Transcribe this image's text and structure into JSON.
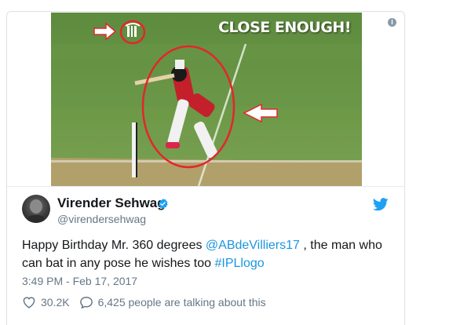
{
  "media": {
    "overlay_title": "CLOSE ENOUGH!"
  },
  "author": {
    "name": "Virender Sehwag",
    "handle": "@virendersehwag"
  },
  "tweet": {
    "text_1": "Happy Birthday Mr. 360 degrees ",
    "mention": "@ABdeVilliers17",
    "text_2": " , the man who can bat in any pose he wishes too ",
    "hashtag": "#IPLlogo",
    "timestamp": "3:49 PM - Feb 17, 2017"
  },
  "actions": {
    "likes": "30.2K",
    "talking": "6,425 people are talking about this"
  },
  "colors": {
    "link": "#1b95e0",
    "like_icon": "#657786",
    "verified": "#1da1f2",
    "annotation": "#e3262c"
  },
  "icons": [
    "info-icon",
    "verified-icon",
    "twitter-bird-icon",
    "heart-icon",
    "comment-icon",
    "arrow-icon"
  ]
}
